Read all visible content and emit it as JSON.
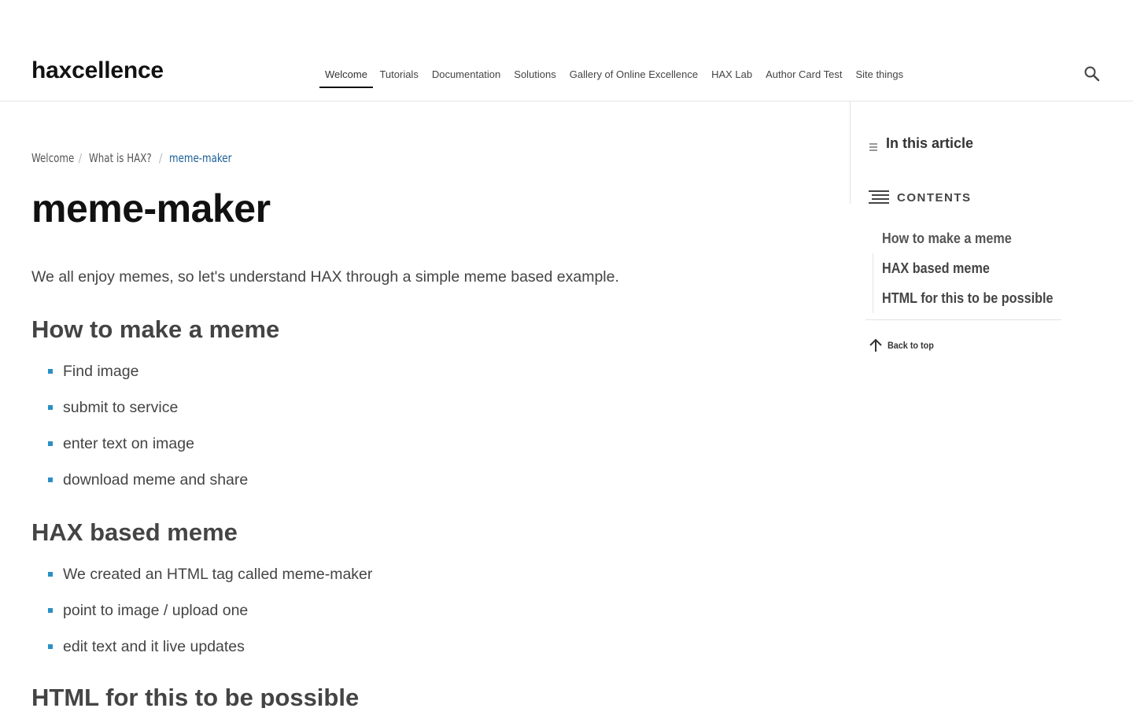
{
  "header": {
    "logo": "haxcellence",
    "nav": [
      {
        "label": "Welcome",
        "active": true
      },
      {
        "label": "Tutorials"
      },
      {
        "label": "Documentation"
      },
      {
        "label": "Solutions"
      },
      {
        "label": "Gallery of Online Excellence"
      },
      {
        "label": "HAX Lab"
      },
      {
        "label": "Author Card Test"
      },
      {
        "label": "Site things"
      }
    ],
    "search_icon": "search-icon"
  },
  "breadcrumb": {
    "items": [
      "Welcome",
      "What is HAX?",
      "meme-maker"
    ],
    "separator": "/"
  },
  "page": {
    "title": "meme-maker",
    "intro": "We all enjoy memes, so let's understand HAX through a simple meme based example.",
    "sections": [
      {
        "heading": "How to make a meme",
        "items": [
          "Find image",
          "submit to service",
          "enter text on image",
          "download meme and share"
        ]
      },
      {
        "heading": "HAX based meme",
        "items": [
          "We created an HTML tag called meme-maker",
          "point to image / upload one",
          "edit text and it live updates"
        ]
      },
      {
        "heading": "HTML for this to be possible",
        "items": []
      }
    ]
  },
  "sidebar": {
    "in_article": "In this article",
    "contents": "CONTENTS",
    "toc": [
      "How to make a meme",
      "HAX based meme",
      "HTML for this to be possible"
    ],
    "back_to_top": "Back to top"
  },
  "colors": {
    "bullet": "#2a8fc4",
    "breadcrumb_current": "#1a5f96",
    "divider": "#e4e4e4"
  }
}
